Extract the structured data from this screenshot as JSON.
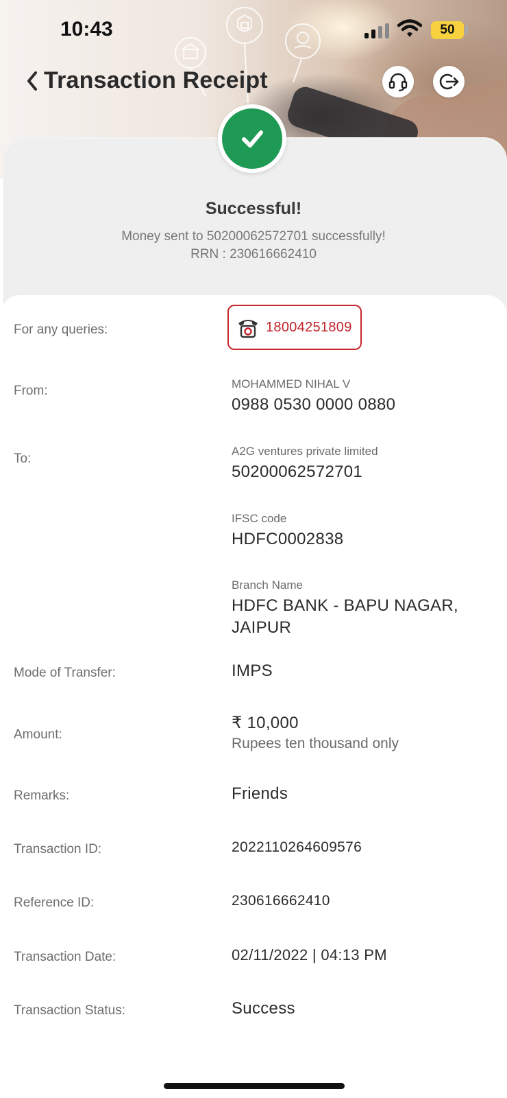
{
  "status_bar": {
    "time": "10:43",
    "battery": "50"
  },
  "header": {
    "title": "Transaction Receipt"
  },
  "summary": {
    "title": "Successful!",
    "message": "Money sent to 50200062572701 successfully!",
    "rrn": "RRN : 230616662410"
  },
  "queries": {
    "label": "For any queries:",
    "phone": "18004251809"
  },
  "from": {
    "label": "From:",
    "name": "MOHAMMED NIHAL V",
    "account": "0988 0530 0000 0880"
  },
  "to": {
    "label": "To:",
    "name": "A2G ventures private limited",
    "account": "50200062572701",
    "ifsc_label": "IFSC code",
    "ifsc": "HDFC0002838",
    "branch_label": "Branch Name",
    "branch_line1": "HDFC BANK - BAPU NAGAR,",
    "branch_line2": "JAIPUR"
  },
  "mode": {
    "label": "Mode of Transfer:",
    "value": "IMPS"
  },
  "amount": {
    "label": "Amount:",
    "value": "₹ 10,000",
    "words": "Rupees ten thousand only"
  },
  "remarks": {
    "label": "Remarks:",
    "value": "Friends"
  },
  "transaction_id": {
    "label": "Transaction ID:",
    "value": "2022110264609576"
  },
  "reference_id": {
    "label": "Reference ID:",
    "value": "230616662410"
  },
  "transaction_date": {
    "label": "Transaction Date:",
    "value": "02/11/2022 | 04:13 PM"
  },
  "transaction_status": {
    "label": "Transaction Status:",
    "value": "Success"
  },
  "icons": {
    "back": "chevron-left-icon",
    "support": "headset-icon",
    "logout": "logout-icon",
    "success": "checkmark-icon",
    "phone": "telephone-icon"
  },
  "colors": {
    "success": "#1f9a55",
    "accent": "#c22229",
    "battery": "#f7d23e"
  }
}
